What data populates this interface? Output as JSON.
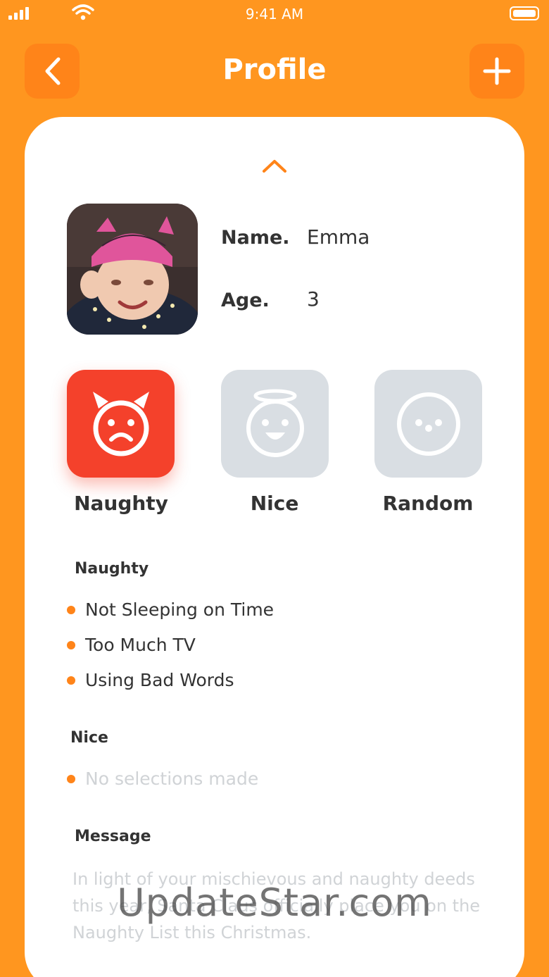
{
  "status_bar": {
    "time": "9:41 AM"
  },
  "header": {
    "title": "Profile",
    "back_icon": "chevron-left-icon",
    "add_icon": "plus-icon"
  },
  "profile": {
    "name_label": "Name.",
    "name_value": "Emma",
    "age_label": "Age.",
    "age_value": "3"
  },
  "modes": [
    {
      "label": "Naughty",
      "icon": "devil-face-icon",
      "selected": true
    },
    {
      "label": "Nice",
      "icon": "angel-face-icon",
      "selected": false
    },
    {
      "label": "Random",
      "icon": "neutral-face-icon",
      "selected": false
    }
  ],
  "naughty_section": {
    "title": "Naughty",
    "items": [
      "Not Sleeping on Time",
      "Too Much TV",
      "Using Bad Words"
    ]
  },
  "nice_section": {
    "title": "Nice",
    "items": [
      "No selections made"
    ]
  },
  "message_section": {
    "title": "Message",
    "text": "In light of your mischievous and naughty deeds this year, Santa Claus officially place you on the Naughty List this Christmas."
  },
  "watermark": "UpdateStar.com",
  "colors": {
    "background": "#FF961F",
    "accent": "#FF8419",
    "naughty": "#F4412B",
    "inactive_tile": "#D9DEE3"
  }
}
